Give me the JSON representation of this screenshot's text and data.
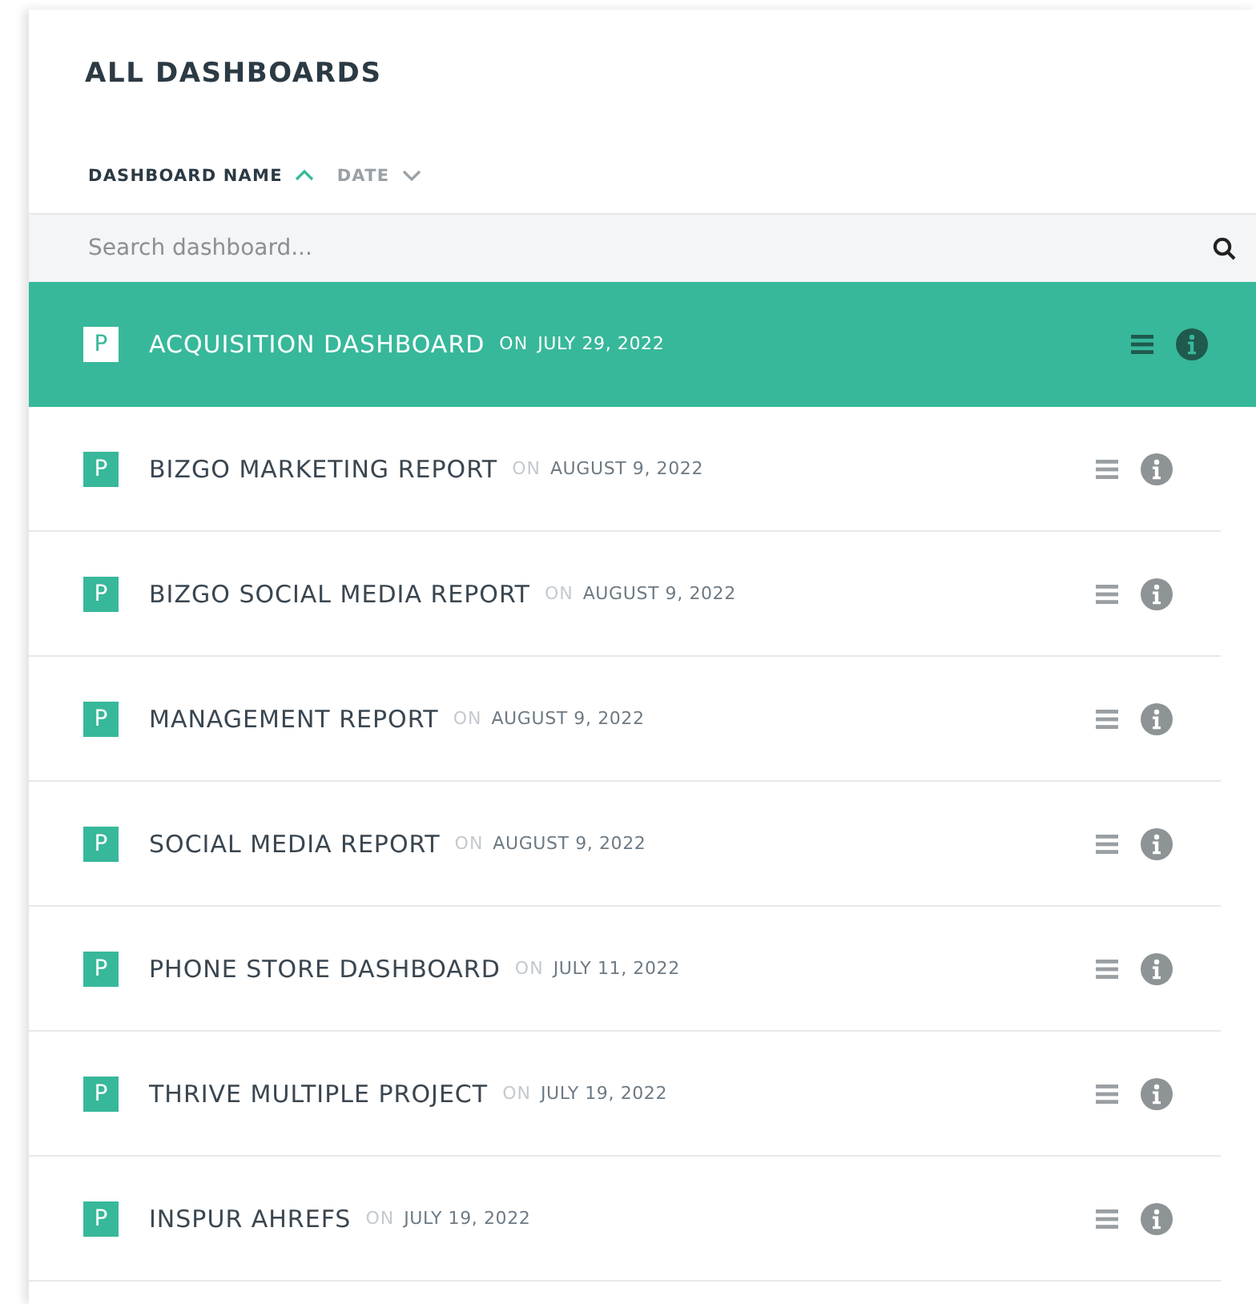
{
  "title": "ALL DASHBOARDS",
  "sort_options": [
    {
      "label": "DASHBOARD NAME",
      "selected": true,
      "ascending": true
    },
    {
      "label": "DATE",
      "selected": false,
      "ascending": false
    }
  ],
  "search": {
    "placeholder": "Search dashboard..."
  },
  "dashboards": [
    {
      "badge": "P",
      "name": "ACQUISITION DASHBOARD",
      "on": "ON",
      "date": "JULY 29, 2022",
      "selected": true
    },
    {
      "badge": "P",
      "name": "BIZGO MARKETING REPORT",
      "on": "ON",
      "date": "AUGUST 9, 2022",
      "selected": false
    },
    {
      "badge": "P",
      "name": "BIZGO SOCIAL MEDIA REPORT",
      "on": "ON",
      "date": "AUGUST 9, 2022",
      "selected": false
    },
    {
      "badge": "P",
      "name": "MANAGEMENT REPORT",
      "on": "ON",
      "date": "AUGUST 9, 2022",
      "selected": false
    },
    {
      "badge": "P",
      "name": "SOCIAL MEDIA REPORT",
      "on": "ON",
      "date": "AUGUST 9, 2022",
      "selected": false
    },
    {
      "badge": "P",
      "name": "PHONE STORE DASHBOARD",
      "on": "ON",
      "date": "JULY 11, 2022",
      "selected": false
    },
    {
      "badge": "P",
      "name": "THRIVE MULTIPLE PROJECT",
      "on": "ON",
      "date": "JULY 19, 2022",
      "selected": false
    },
    {
      "badge": "P",
      "name": "INSPUR AHREFS",
      "on": "ON",
      "date": "JULY 19, 2022",
      "selected": false
    }
  ]
}
